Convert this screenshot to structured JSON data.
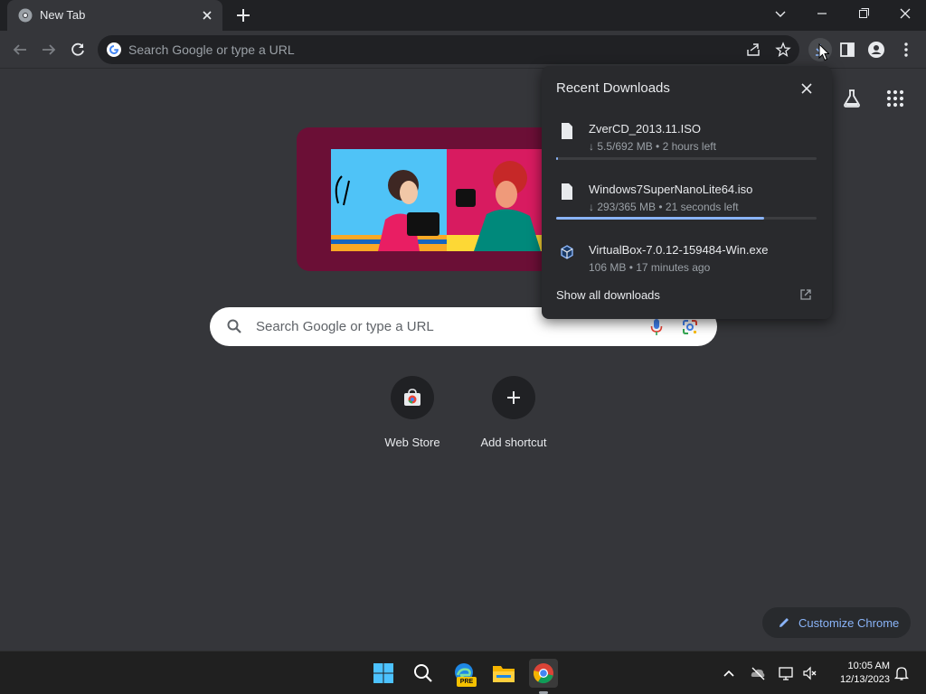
{
  "tab": {
    "title": "New Tab"
  },
  "omnibox": {
    "placeholder": "Search Google or type a URL"
  },
  "downloads": {
    "heading": "Recent Downloads",
    "items": [
      {
        "name": "ZverCD_2013.11.ISO",
        "meta": "↓ 5.5/692 MB • 2 hours left",
        "progress": 0.008
      },
      {
        "name": "Windows7SuperNanoLite64.iso",
        "meta": "↓ 293/365 MB • 21 seconds left",
        "progress": 0.8
      },
      {
        "name": "VirtualBox-7.0.12-159484-Win.exe",
        "meta": "106 MB • 17 minutes ago"
      }
    ],
    "show_all": "Show all downloads"
  },
  "ntp": {
    "search_placeholder": "Search Google or type a URL",
    "shortcuts": [
      {
        "label": "Web Store"
      },
      {
        "label": "Add shortcut"
      }
    ],
    "customize_label": "Customize Chrome"
  },
  "taskbar": {
    "time": "10:05 AM",
    "date": "12/13/2023",
    "edge_badge": "PRE"
  },
  "colors": {
    "accent": "#8ab4f8",
    "frame": "#202124",
    "surface": "#35363a"
  }
}
